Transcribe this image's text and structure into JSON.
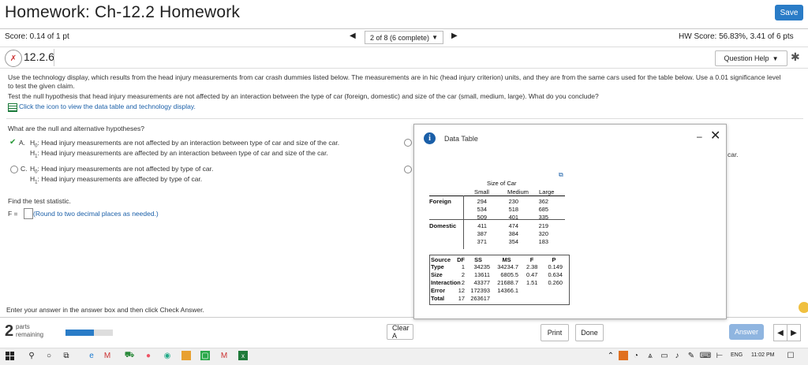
{
  "header": {
    "title": "Homework: Ch-12.2 Homework",
    "save_label": "Save"
  },
  "scorebar": {
    "score_label": "Score: 0.14 of 1 pt",
    "nav_text": "2 of 8 (6 complete)",
    "hw_score_label": "HW Score: 56.83%, 3.41 of 6 pts"
  },
  "question": {
    "number": "12.2.6",
    "help_label": "Question Help",
    "prompt_line1": "Use the technology display, which results from the head injury measurements from car crash dummies listed below. The measurements are in hic (head injury criterion) units, and they are from the same cars used for the table below. Use a 0.01 significance level",
    "prompt_line2": "to test the given claim.",
    "prompt_line3": "Test the null hypothesis that head injury measurements are not affected by an interaction between the type of car (foreign, domestic) and size of the car (small, medium, large). What do you conclude?",
    "data_link": "Click the icon to view the data table and technology display.",
    "hyp_question": "What are the null and alternative hypotheses?",
    "optA_h0": "Head injury measurements are not affected by an interaction between type of car and size of the car.",
    "optA_h1": "Head injury measurements are affected by an interaction between type of car and size of the car.",
    "optC_h0": "Head injury measurements are not affected by type of car.",
    "optC_h1": "Head injury measurements are affected by type of car.",
    "optA_letter": "A.",
    "optC_letter": "C.",
    "h0": "H",
    "h0_sub": "0",
    "h1": "H",
    "h1_sub": "1",
    "right_cut": "car.",
    "test_stat_q": "Find the test statistic.",
    "f_label": "F =",
    "f_hint": "(Round to two decimal places as needed.)",
    "instruction": "Enter your answer in the answer box and then click Check Answer."
  },
  "bottom": {
    "parts_num": "2",
    "parts_label": "parts",
    "remaining_label": "remaining",
    "progress": 0.6,
    "clear_label": "Clear A",
    "answer_label": "Answer"
  },
  "modal": {
    "title": "Data Table",
    "minimize": "–",
    "close": "✕",
    "size_header": "Size of Car",
    "col_small": "Small",
    "col_medium": "Medium",
    "col_large": "Large",
    "row_foreign": "Foreign",
    "row_domestic": "Domestic",
    "data": [
      [
        "294",
        "230",
        "362"
      ],
      [
        "534",
        "518",
        "685"
      ],
      [
        "509",
        "401",
        "335"
      ],
      [
        "411",
        "474",
        "219"
      ],
      [
        "387",
        "384",
        "320"
      ],
      [
        "371",
        "354",
        "183"
      ]
    ],
    "anova_headers": [
      "Source",
      "DF",
      "SS",
      "MS",
      "F",
      "P"
    ],
    "anova_rows": [
      [
        "Type",
        "1",
        "34235",
        "34234.7",
        "2.38",
        "0.149"
      ],
      [
        "Size",
        "2",
        "13611",
        "6805.5",
        "0.47",
        "0.634"
      ],
      [
        "Interaction",
        "2",
        "43377",
        "21688.7",
        "1.51",
        "0.260"
      ],
      [
        "Error",
        "12",
        "172393",
        "14366.1",
        "",
        ""
      ],
      [
        "Total",
        "17",
        "263617",
        "",
        "",
        ""
      ]
    ],
    "print_label": "Print",
    "done_label": "Done"
  },
  "taskbar": {
    "lang": "ENG",
    "time": "11:02 PM"
  }
}
